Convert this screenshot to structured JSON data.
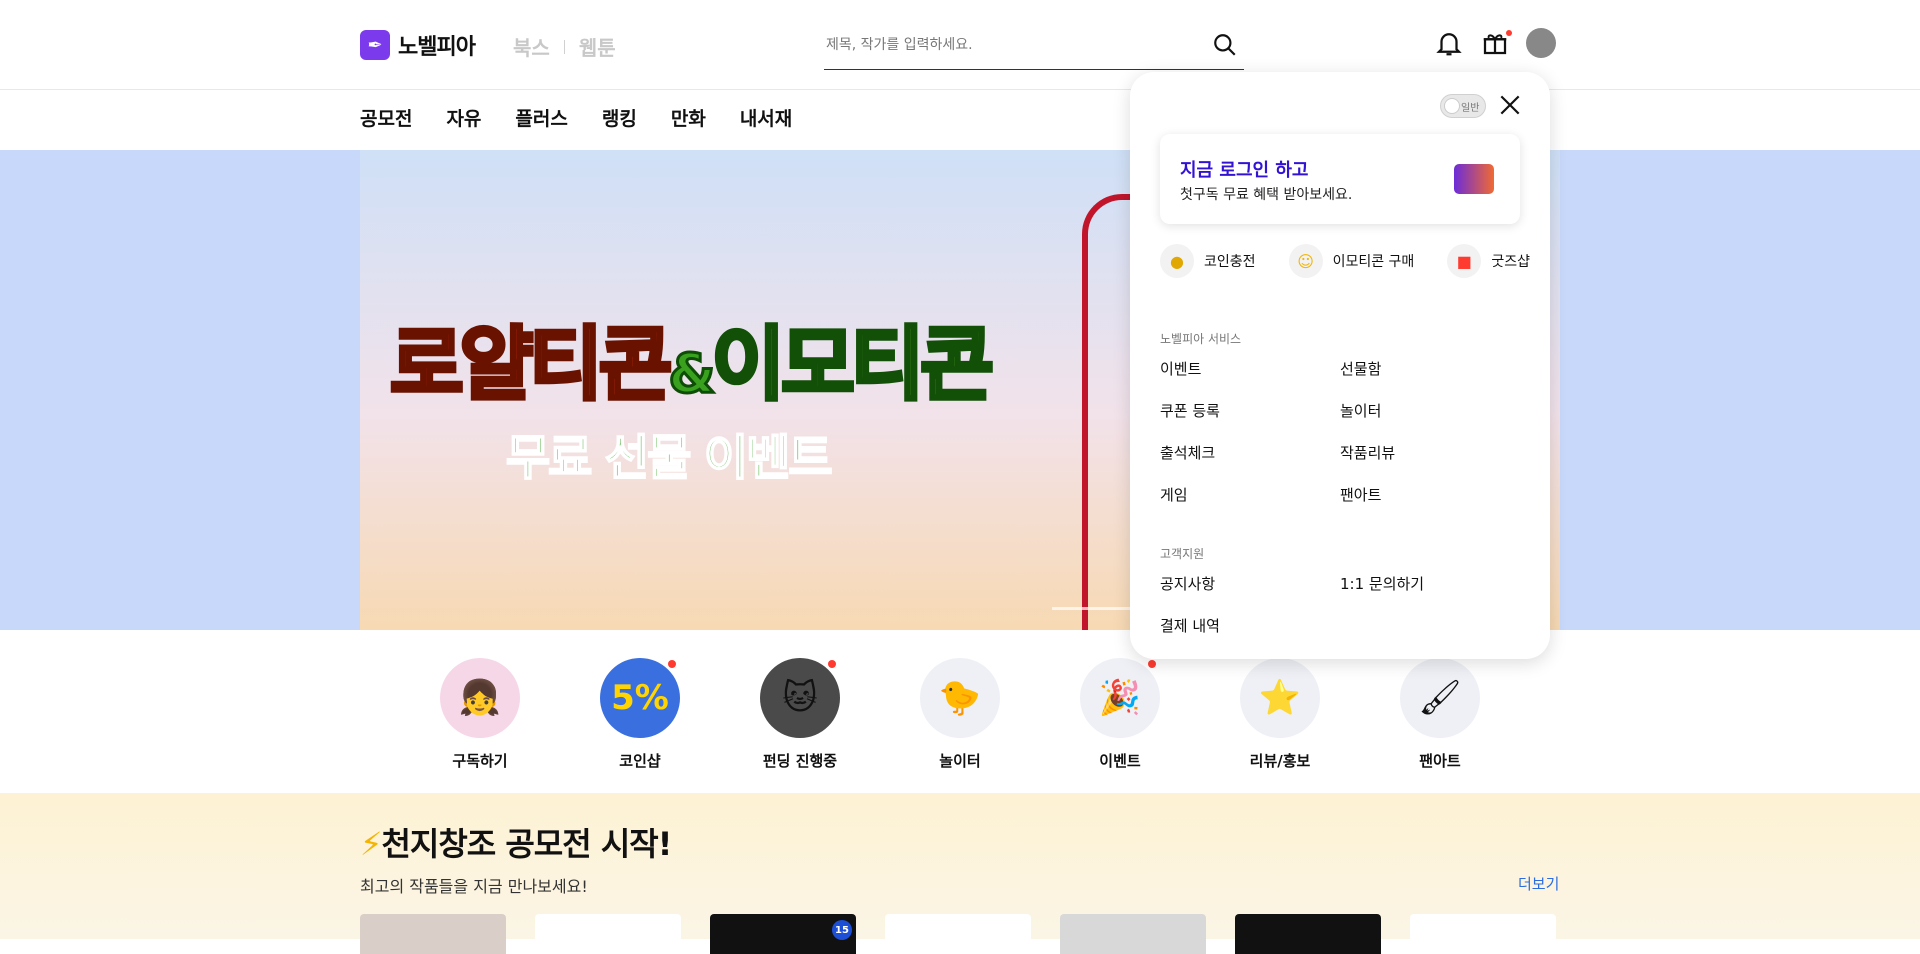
{
  "header": {
    "logo_text": "노벨피아",
    "brand_books": "북스",
    "brand_webtoon": "웹툰",
    "search_placeholder": "제목, 작가를 입력하세요."
  },
  "nav": [
    "공모전",
    "자유",
    "플러스",
    "랭킹",
    "만화",
    "내서재"
  ],
  "hero": {
    "title_a": "로얄티콘",
    "title_amp": "&",
    "title_b": "이모티콘",
    "subtitle": "무료 선물 이벤트"
  },
  "categories": [
    {
      "label": "구독하기",
      "icon": "subscribe-icon",
      "badge": false
    },
    {
      "label": "코인샵",
      "icon": "coin-shop-icon",
      "badge": true
    },
    {
      "label": "펀딩 진행중",
      "icon": "funding-icon",
      "badge": true
    },
    {
      "label": "놀이터",
      "icon": "playground-icon",
      "badge": false
    },
    {
      "label": "이벤트",
      "icon": "event-icon",
      "badge": true
    },
    {
      "label": "리뷰/홍보",
      "icon": "review-icon",
      "badge": false
    },
    {
      "label": "팬아트",
      "icon": "fanart-icon",
      "badge": false
    }
  ],
  "contest": {
    "title": "천지창조 공모전 시작!",
    "description": "최고의 작품들을 지금 만나보세요!",
    "more": "더보기",
    "age_badge": "15"
  },
  "panel": {
    "toggle_label": "일반",
    "login_title": "지금 로그인 하고",
    "login_desc": "첫구독 무료 혜택 받아보세요.",
    "quick": [
      {
        "label": "코인충전",
        "icon": "coin-icon"
      },
      {
        "label": "이모티콘 구매",
        "icon": "smile-icon"
      },
      {
        "label": "굿즈샵",
        "icon": "shopping-bag-icon"
      }
    ],
    "service_title": "노벨피아 서비스",
    "service_items": [
      "이벤트",
      "선물함",
      "쿠폰 등록",
      "놀이터",
      "출석체크",
      "작품리뷰",
      "게임",
      "팬아트"
    ],
    "support_title": "고객지원",
    "support_items": [
      "공지사항",
      "1:1 문의하기",
      "결제 내역"
    ]
  }
}
